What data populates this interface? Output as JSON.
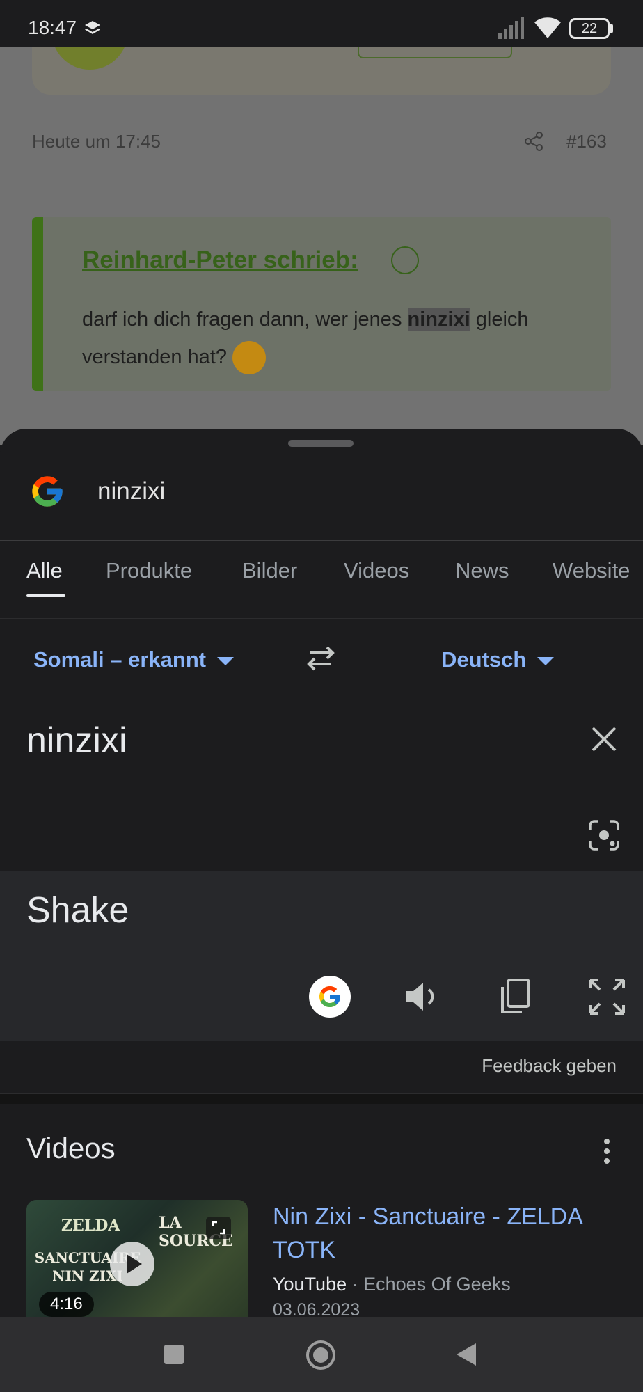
{
  "status_bar": {
    "time": "18:47",
    "battery": "22"
  },
  "background_page": {
    "card_text": "...",
    "timestamp": "Heute um 17:45",
    "post_number": "#163",
    "quote_author": "Reinhard-Peter schrieb:",
    "quote_text_before": "darf ich dich fragen dann, wer jenes ",
    "quote_highlight": "ninzixi",
    "quote_text_after": " gleich verstanden hat? "
  },
  "search": {
    "query": "ninzixi"
  },
  "tabs": [
    "Alle",
    "Produkte",
    "Bilder",
    "Videos",
    "News",
    "Website"
  ],
  "translate": {
    "source_lang": "Somali – erkannt",
    "target_lang": "Deutsch",
    "source_text": "ninzixi",
    "result_text": "Shake",
    "feedback": "Feedback geben"
  },
  "videos": {
    "title": "Videos",
    "items": [
      {
        "title": "Nin Zixi - Sanctuaire - ZELDA TOTK",
        "source": "YouTube",
        "channel": "Echoes Of Geeks",
        "date": "03.06.2023",
        "duration": "4:16",
        "thumb_text_1": "ZELDA",
        "thumb_text_2": "SANCTUAIRE NIN ZIXI",
        "thumb_text_3": "LA SOURCE"
      }
    ]
  },
  "colors": {
    "accent": "#8ab4f8",
    "sheet_bg": "#1c1c1e",
    "result_bg": "#27282b"
  },
  "icons": [
    "google-logo-icon",
    "swap-icon",
    "close-icon",
    "lens-icon",
    "speaker-icon",
    "copy-icon",
    "fullscreen-icon",
    "more-icon",
    "play-icon"
  ]
}
